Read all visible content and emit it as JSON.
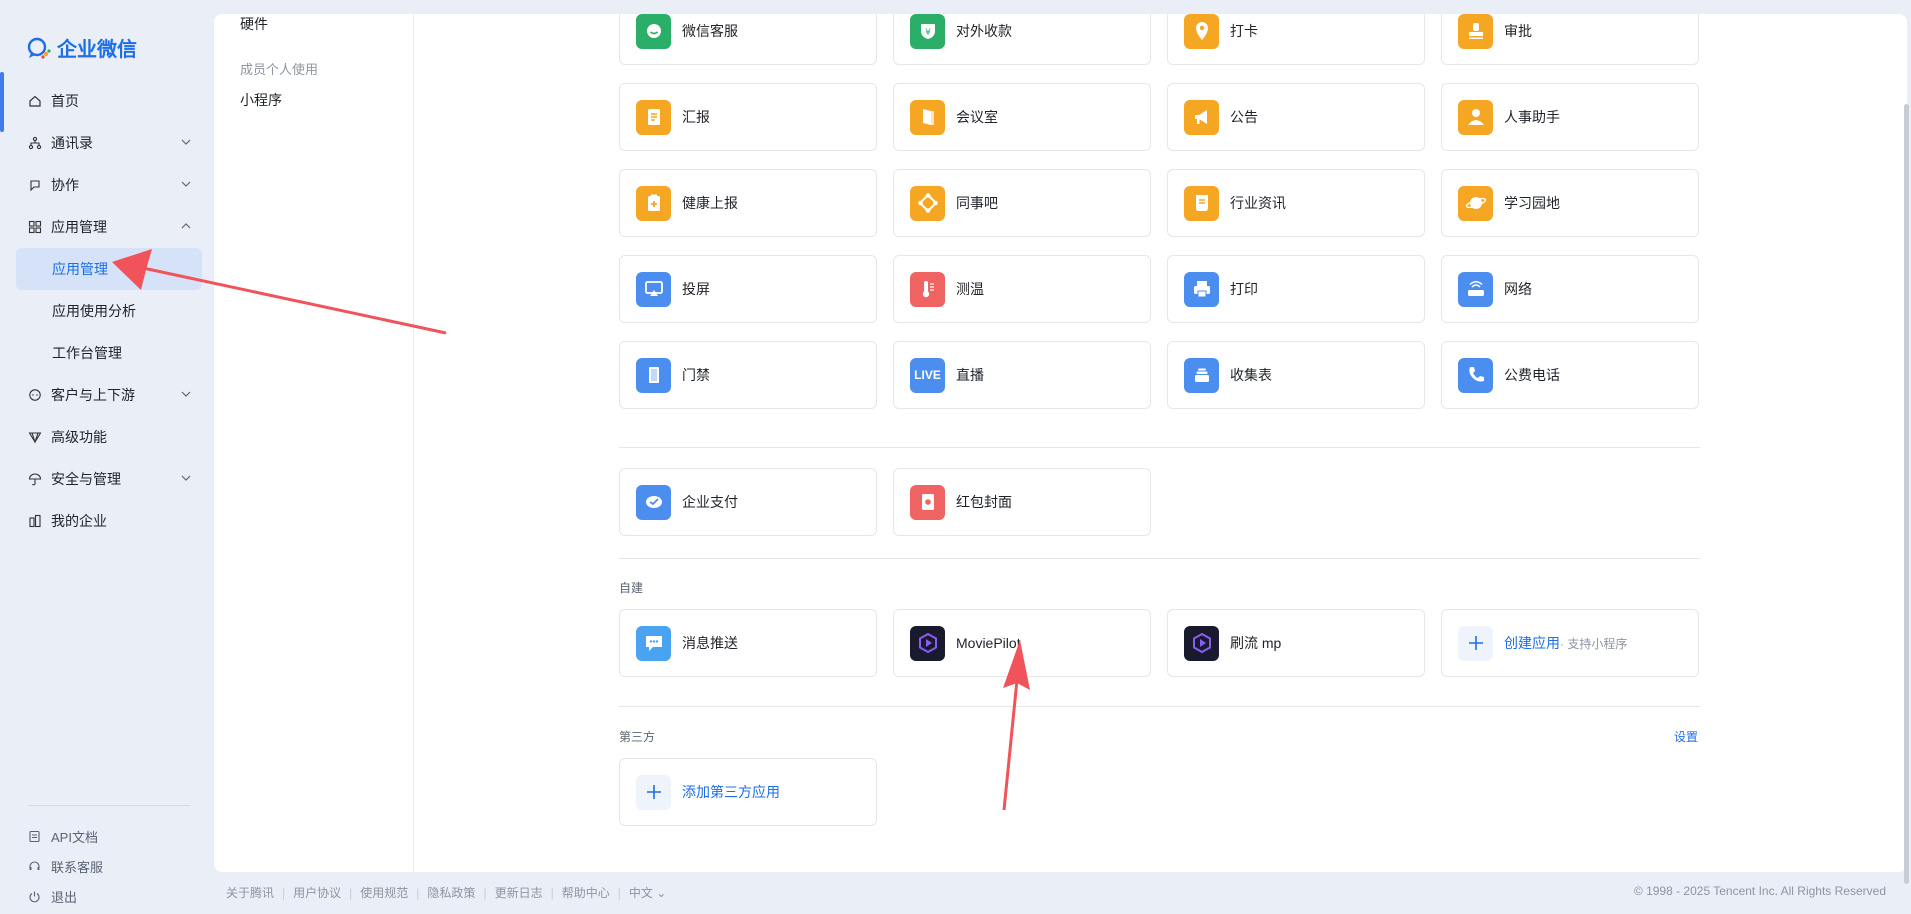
{
  "brand": {
    "name": "企业微信"
  },
  "sidebar": {
    "items": [
      {
        "label": "首页",
        "icon": "home-icon"
      },
      {
        "label": "通讯录",
        "icon": "org-chart-icon"
      },
      {
        "label": "协作",
        "icon": "collab-icon"
      },
      {
        "label": "应用管理",
        "icon": "grid-icon"
      },
      {
        "label": "客户与上下游",
        "icon": "chat-bubble-icon"
      },
      {
        "label": "高级功能",
        "icon": "diamond-icon"
      },
      {
        "label": "安全与管理",
        "icon": "umbrella-icon"
      },
      {
        "label": "我的企业",
        "icon": "building-icon"
      }
    ],
    "subitems": [
      "应用管理",
      "应用使用分析",
      "工作台管理"
    ],
    "bottom": [
      "API文档",
      "联系客服",
      "退出"
    ]
  },
  "subnav": {
    "hardware": "硬件",
    "group_label": "成员个人使用",
    "mini_program": "小程序"
  },
  "apps": {
    "basic": [
      {
        "name": "微信客服",
        "color": "#2bae67",
        "icon": "wechat-service-icon"
      },
      {
        "name": "对外收款",
        "color": "#2bae67",
        "icon": "yuan-shield-icon"
      },
      {
        "name": "打卡",
        "color": "#f5a623",
        "icon": "location-pin-icon"
      },
      {
        "name": "审批",
        "color": "#f5a623",
        "icon": "stamp-icon"
      },
      {
        "name": "汇报",
        "color": "#f5a623",
        "icon": "report-icon"
      },
      {
        "name": "会议室",
        "color": "#f5a623",
        "icon": "door-icon"
      },
      {
        "name": "公告",
        "color": "#f5a623",
        "icon": "megaphone-icon"
      },
      {
        "name": "人事助手",
        "color": "#f5a623",
        "icon": "person-icon"
      },
      {
        "name": "健康上报",
        "color": "#f5a623",
        "icon": "clipboard-plus-icon"
      },
      {
        "name": "同事吧",
        "color": "#f5a623",
        "icon": "network-icon"
      },
      {
        "name": "行业资讯",
        "color": "#f5a623",
        "icon": "news-icon"
      },
      {
        "name": "学习园地",
        "color": "#f5a623",
        "icon": "planet-icon"
      },
      {
        "name": "投屏",
        "color": "#4c8ef0",
        "icon": "screen-cast-icon"
      },
      {
        "name": "测温",
        "color": "#f06363",
        "icon": "thermometer-icon"
      },
      {
        "name": "打印",
        "color": "#4c8ef0",
        "icon": "printer-icon"
      },
      {
        "name": "网络",
        "color": "#4c8ef0",
        "icon": "router-icon"
      },
      {
        "name": "门禁",
        "color": "#4c8ef0",
        "icon": "door-access-icon"
      },
      {
        "name": "直播",
        "color": "#4c8ef0",
        "icon": "live-icon",
        "badge": "LIVE"
      },
      {
        "name": "收集表",
        "color": "#4c8ef0",
        "icon": "stack-icon"
      },
      {
        "name": "公费电话",
        "color": "#4c8ef0",
        "icon": "phone-icon"
      }
    ],
    "payment": [
      {
        "name": "企业支付",
        "color": "#4c8ef0",
        "icon": "pay-icon"
      },
      {
        "name": "红包封面",
        "color": "#f06363",
        "icon": "red-packet-icon"
      }
    ],
    "custom_label": "自建",
    "custom": [
      {
        "name": "消息推送",
        "color": "#4aa3f0",
        "icon": "message-push-icon"
      },
      {
        "name": "MoviePilot",
        "color": "#1a1a2e",
        "icon": "moviepilot-icon"
      },
      {
        "name": "刷流 mp",
        "color": "#1a1a2e",
        "icon": "moviepilot-icon"
      }
    ],
    "create_app": {
      "label": "创建应用",
      "note": "· 支持小程序"
    },
    "third_party_label": "第三方",
    "settings_label": "设置",
    "add_third_party": "添加第三方应用"
  },
  "footer": {
    "links": [
      "关于腾讯",
      "用户协议",
      "使用规范",
      "隐私政策",
      "更新日志",
      "帮助中心"
    ],
    "language": "中文",
    "copyright": "© 1998 - 2025 Tencent Inc. All Rights Reserved"
  },
  "annotation_color": "#f0545a"
}
